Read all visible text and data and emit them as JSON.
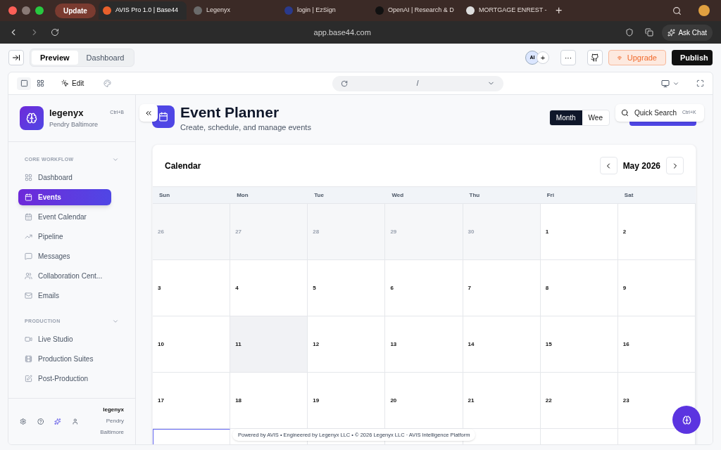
{
  "browser": {
    "update_button": "Update",
    "tabs": [
      {
        "title": "AVIS Pro 1.0 | Base44",
        "selected": true,
        "color": "#e8602c"
      },
      {
        "title": "Legenyx",
        "selected": false,
        "color": "#6b6b6b"
      },
      {
        "title": "login | EzSign",
        "selected": false,
        "color": "#2a3a8c"
      },
      {
        "title": "OpenAI | Research & D",
        "selected": false,
        "color": "#111111"
      },
      {
        "title": "MORTGAGE ENREST -",
        "selected": false,
        "color": "#dddddd"
      }
    ],
    "new_tab": "+",
    "url": "app.base44.com",
    "ask_chat": "Ask Chat"
  },
  "builder": {
    "view_tabs": [
      {
        "label": "Preview",
        "selected": true
      },
      {
        "label": "Dashboard",
        "selected": false
      }
    ],
    "ai_badge": "AI",
    "add": "+",
    "more": "···",
    "upgrade": "Upgrade",
    "publish": "Publish",
    "edit": "Edit",
    "route": "/"
  },
  "sidebar": {
    "app_name": "legenyx",
    "app_subtitle": "Pendry Baltimore",
    "shortcut": "Ctrl+B",
    "sections": [
      {
        "title": "CORE WORKFLOW",
        "expanded": true,
        "items": [
          {
            "label": "Dashboard",
            "selected": false
          },
          {
            "label": "Events",
            "selected": true
          },
          {
            "label": "Event Calendar",
            "selected": false
          },
          {
            "label": "Pipeline",
            "selected": false
          },
          {
            "label": "Messages",
            "selected": false
          },
          {
            "label": "Collaboration Cent...",
            "selected": false
          },
          {
            "label": "Emails",
            "selected": false
          }
        ]
      },
      {
        "title": "PRODUCTION",
        "expanded": true,
        "items": [
          {
            "label": "Live Studio",
            "selected": false
          },
          {
            "label": "Production Suites",
            "selected": false
          },
          {
            "label": "Post-Production",
            "selected": false
          }
        ]
      }
    ],
    "user": {
      "name": "legenyx",
      "org": "Pendry Baltimore"
    }
  },
  "page": {
    "title": "Event Planner",
    "subtitle": "Create, schedule, and manage events",
    "view_toggle": [
      {
        "label": "Month",
        "selected": true
      },
      {
        "label": "Wee",
        "selected": false
      }
    ],
    "quick_search": {
      "label": "Quick Search",
      "shortcut": "Ctrl+K"
    },
    "calendar": {
      "title": "Calendar",
      "month": "May 2026",
      "weekdays": [
        "Sun",
        "Mon",
        "Tue",
        "Wed",
        "Thu",
        "Fri",
        "Sat"
      ],
      "weeks": [
        [
          {
            "label": "26",
            "in_month": false
          },
          {
            "label": "27",
            "in_month": false
          },
          {
            "label": "28",
            "in_month": false
          },
          {
            "label": "29",
            "in_month": false
          },
          {
            "label": "30",
            "in_month": false
          },
          {
            "label": "1",
            "in_month": true
          },
          {
            "label": "2",
            "in_month": true
          }
        ],
        [
          {
            "label": "3",
            "in_month": true
          },
          {
            "label": "4",
            "in_month": true
          },
          {
            "label": "5",
            "in_month": true
          },
          {
            "label": "6",
            "in_month": true
          },
          {
            "label": "7",
            "in_month": true
          },
          {
            "label": "8",
            "in_month": true
          },
          {
            "label": "9",
            "in_month": true
          }
        ],
        [
          {
            "label": "10",
            "in_month": true
          },
          {
            "label": "11",
            "in_month": true,
            "highlighted": true
          },
          {
            "label": "12",
            "in_month": true
          },
          {
            "label": "13",
            "in_month": true
          },
          {
            "label": "14",
            "in_month": true
          },
          {
            "label": "15",
            "in_month": true
          },
          {
            "label": "16",
            "in_month": true
          }
        ],
        [
          {
            "label": "17",
            "in_month": true
          },
          {
            "label": "18",
            "in_month": true
          },
          {
            "label": "19",
            "in_month": true
          },
          {
            "label": "20",
            "in_month": true
          },
          {
            "label": "21",
            "in_month": true
          },
          {
            "label": "22",
            "in_month": true
          },
          {
            "label": "23",
            "in_month": true
          }
        ],
        [
          {
            "selected": true
          },
          {
            "selected": false
          },
          {
            "selected": false
          },
          {
            "selected": false
          },
          {
            "selected": false
          },
          {
            "selected": false
          },
          {
            "selected": false
          }
        ]
      ]
    },
    "footer": "Powered by AVIS • Engineered by Legenyx LLC • © 2026 Legenyx LLC · AVIS Intelligence Platform"
  }
}
